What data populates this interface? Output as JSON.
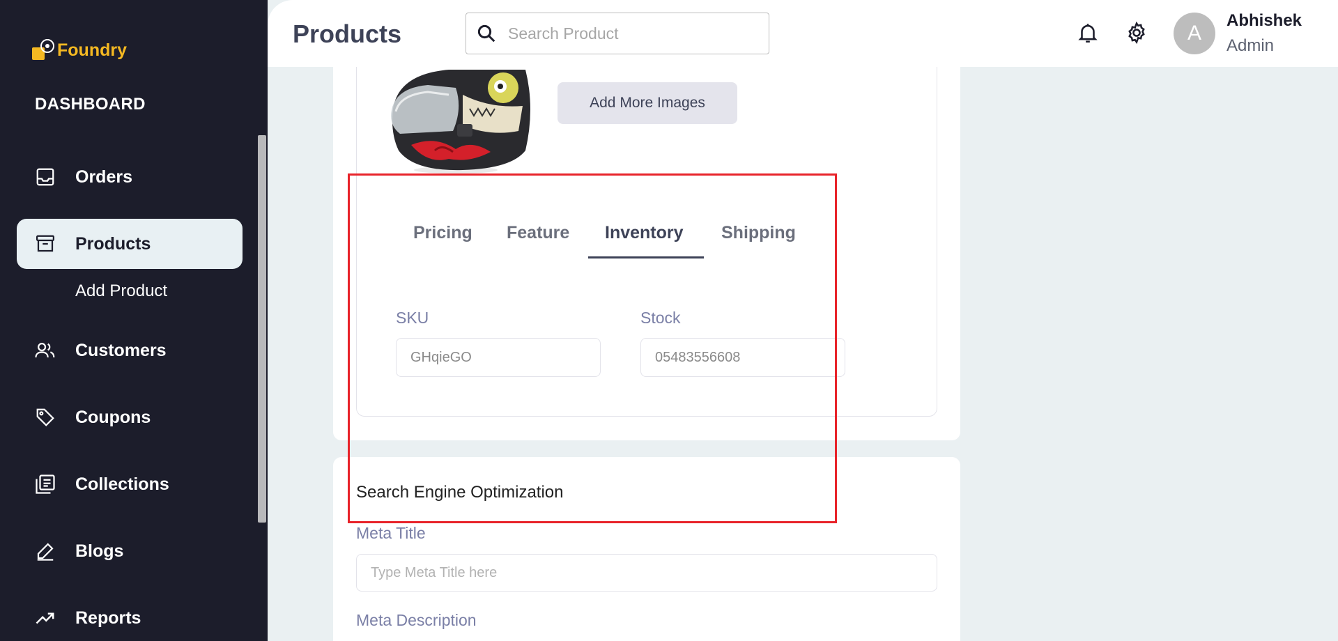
{
  "brand": {
    "name": "Foundry",
    "accent": "#f5b922"
  },
  "sidebar": {
    "section_title": "DASHBOARD",
    "items": [
      {
        "label": "Orders",
        "icon": "inbox-icon"
      },
      {
        "label": "Products",
        "icon": "archive-icon",
        "active": true
      },
      {
        "label": "Customers",
        "icon": "people-icon"
      },
      {
        "label": "Coupons",
        "icon": "tag-icon"
      },
      {
        "label": "Collections",
        "icon": "library-icon"
      },
      {
        "label": "Blogs",
        "icon": "pen-icon"
      },
      {
        "label": "Reports",
        "icon": "trending-up-icon"
      }
    ],
    "sub_items": [
      {
        "label": "Add Product"
      }
    ]
  },
  "header": {
    "title": "Products",
    "search_placeholder": "Search Product",
    "user": {
      "initial": "A",
      "name": "Abhishek",
      "role": "Admin"
    }
  },
  "product_card": {
    "add_images_label": "Add More Images",
    "tabs": [
      {
        "label": "Pricing"
      },
      {
        "label": "Feature"
      },
      {
        "label": "Inventory",
        "active": true
      },
      {
        "label": "Shipping"
      }
    ],
    "inventory": {
      "sku_label": "SKU",
      "sku_value": "GHqieGO",
      "stock_label": "Stock",
      "stock_value": "05483556608"
    }
  },
  "seo_card": {
    "title": "Search Engine Optimization",
    "meta_title_label": "Meta Title",
    "meta_title_placeholder": "Type Meta Title here",
    "meta_description_label": "Meta Description"
  },
  "colors": {
    "sidebar_bg": "#1c1d2b",
    "highlight": "#e8232a",
    "page_bg": "#eaf0f2"
  }
}
